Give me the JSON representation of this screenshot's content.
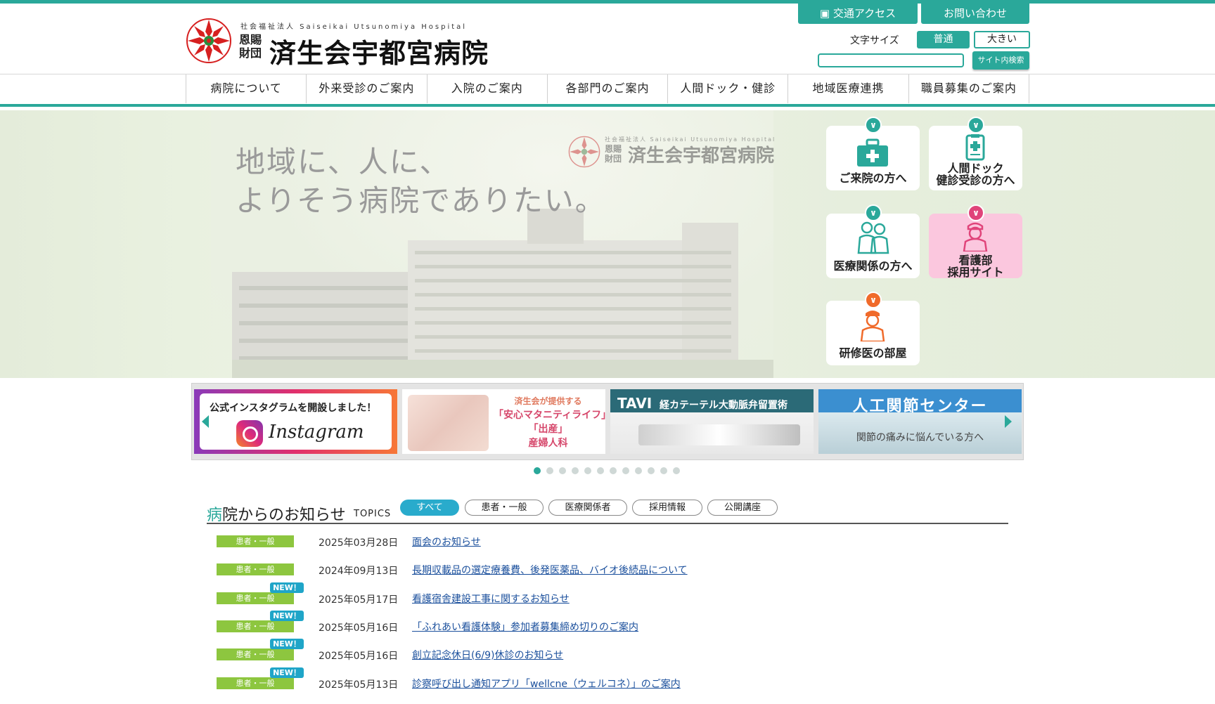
{
  "header": {
    "logo_sub": "社会福祉法人 Saiseikai Utsunomiya Hospital",
    "logo_small": "恩賜財団",
    "logo_main": "済生会宇都宮病院",
    "access_label": "交通アクセス",
    "contact_label": "お問い合わせ",
    "font_size_label": "文字サイズ",
    "font_normal_label": "普通",
    "font_large_label": "大きい",
    "search_placeholder": "",
    "search_button_label": "サイト内検索"
  },
  "nav": {
    "items": [
      {
        "label": "病院について"
      },
      {
        "label": "外来受診のご案内"
      },
      {
        "label": "入院のご案内"
      },
      {
        "label": "各部門のご案内"
      },
      {
        "label": "人間ドック・健診"
      },
      {
        "label": "地域医療連携"
      },
      {
        "label": "職員募集のご案内"
      }
    ]
  },
  "hero": {
    "tagline_line1": "地域に、人に、",
    "tagline_line2": "よりそう病院でありたい。",
    "logo_sub": "社会福祉法人 Saiseikai Utsunomiya Hospital",
    "logo_small": "恩賜財団",
    "logo_main": "済生会宇都宮病院",
    "quick_links": [
      {
        "label": "ご来院の方へ",
        "icon": "first-aid-kit-icon",
        "color": "#2aa89a"
      },
      {
        "label": "人間ドック 健診受診の方へ",
        "label_line1": "人間ドック",
        "label_line2": "健診受診の方へ",
        "icon": "clipboard-icon",
        "color": "#2aa89a"
      },
      {
        "label": "医療関係の方へ",
        "icon": "medical-staff-icon",
        "color": "#2aa89a"
      },
      {
        "label": "看護部 採用サイト",
        "label_line1": "看護部",
        "label_line2": "採用サイト",
        "icon": "nurse-icon",
        "color": "#e0447a"
      },
      {
        "label": "研修医の部屋",
        "icon": "resident-doctor-icon",
        "color": "#f06a2a"
      }
    ]
  },
  "banners": {
    "instagram": {
      "line1": "公式インスタグラムを開設しました！",
      "line2": "Instagram"
    },
    "maternity": {
      "line1": "済生会が提供する",
      "line2": "「安心マタニティライフ」",
      "line3": "「出産」",
      "line4": "産婦人科"
    },
    "tavi": {
      "line1": "TAVI",
      "line2": "経カテーテル大動脈弁留置術"
    },
    "joint": {
      "line1": "人工関節センター",
      "line2": "関節の痛みに悩んでいる方へ"
    },
    "dot_count": 12,
    "active_dot": 0
  },
  "news": {
    "title_first": "病",
    "title_rest": "院からのお知らせ",
    "topics_label": "TOPICS",
    "filters": [
      {
        "label": "すべて",
        "active": true
      },
      {
        "label": "患者・一般",
        "active": false
      },
      {
        "label": "医療関係者",
        "active": false
      },
      {
        "label": "採用情報",
        "active": false
      },
      {
        "label": "公開講座",
        "active": false
      }
    ],
    "new_badge": "NEW！",
    "items": [
      {
        "category": "患者・一般",
        "date": "2025年03月28日",
        "title": "面会のお知らせ",
        "is_new": false
      },
      {
        "category": "患者・一般",
        "date": "2024年09月13日",
        "title": "長期収載品の選定療養費、後発医薬品、バイオ後続品について",
        "is_new": false
      },
      {
        "category": "患者・一般",
        "date": "2025年05月17日",
        "title": "看護宿舎建設工事に関するお知らせ",
        "is_new": true
      },
      {
        "category": "患者・一般",
        "date": "2025年05月16日",
        "title": "「ふれあい看護体験」参加者募集締め切りのご案内",
        "is_new": true
      },
      {
        "category": "患者・一般",
        "date": "2025年05月16日",
        "title": "創立記念休日(6/9)休診のお知らせ",
        "is_new": true
      },
      {
        "category": "患者・一般",
        "date": "2025年05月13日",
        "title": "診察呼び出し通知アプリ「wellcne（ウェルコネ）」のご案内",
        "is_new": true
      }
    ]
  },
  "colors": {
    "brand": "#2aa89a",
    "category": "#8dc63f",
    "new_badge": "#1fa5c8",
    "link": "#1a4f9c"
  }
}
